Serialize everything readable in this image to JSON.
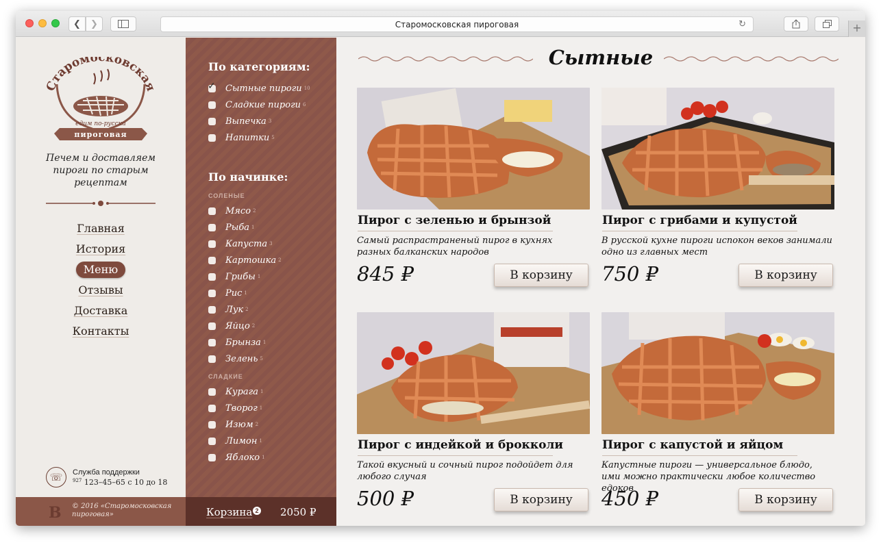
{
  "browser": {
    "url_title": "Старомосковская пироговая"
  },
  "brand": {
    "logo_name": "Старомосковская",
    "logo_motto": "едим по-русски",
    "logo_ribbon": "пироговая",
    "tagline": "Печем и доставляем пироги по старым рецептам",
    "accent": "#8b5748"
  },
  "menu": [
    {
      "label": "Главная"
    },
    {
      "label": "История"
    },
    {
      "label": "Меню",
      "active": true
    },
    {
      "label": "Отзывы"
    },
    {
      "label": "Доставка"
    },
    {
      "label": "Контакты"
    }
  ],
  "support": {
    "label": "Служба поддержки",
    "phone_code": "927",
    "phone": "123–45–65",
    "hours": "с 10 до 18"
  },
  "footer": {
    "copyright": "© 2016 «Старомосковская пироговая»"
  },
  "filters": {
    "categories_heading": "По категориям:",
    "categories": [
      {
        "label": "Сытные пироги",
        "count": "10",
        "checked": true
      },
      {
        "label": "Сладкие пироги",
        "count": "6",
        "checked": false
      },
      {
        "label": "Выпечка",
        "count": "3",
        "checked": false
      },
      {
        "label": "Напитки",
        "count": "5",
        "checked": false
      }
    ],
    "filling_heading": "По начинке:",
    "salty_label": "СОЛЕНЫЕ",
    "salty": [
      {
        "label": "Мясо",
        "count": "2"
      },
      {
        "label": "Рыба",
        "count": "1"
      },
      {
        "label": "Капуста",
        "count": "3"
      },
      {
        "label": "Картошка",
        "count": "2"
      },
      {
        "label": "Грибы",
        "count": "1"
      },
      {
        "label": "Рис",
        "count": "1"
      },
      {
        "label": "Лук",
        "count": "2"
      },
      {
        "label": "Яйцо",
        "count": "2"
      },
      {
        "label": "Брынза",
        "count": "1"
      },
      {
        "label": "Зелень",
        "count": "5"
      }
    ],
    "sweet_label": "СЛАДКИЕ",
    "sweet": [
      {
        "label": "Курага",
        "count": "1"
      },
      {
        "label": "Творог",
        "count": "1"
      },
      {
        "label": "Изюм",
        "count": "2"
      },
      {
        "label": "Лимон",
        "count": "1"
      },
      {
        "label": "Яблоко",
        "count": "1"
      }
    ]
  },
  "cart": {
    "label": "Корзина",
    "count": "2",
    "total": "2050 ₽"
  },
  "main": {
    "title": "Сытные",
    "button_label": "В корзину",
    "products": [
      {
        "title": "Пирог с зеленью и брынзой",
        "desc": "Самый распрастраненый пирог в кухнях разных балканских народов",
        "price": "845 ₽"
      },
      {
        "title": "Пирог с грибами и купустой",
        "desc": "В русской кухне пироги испокон веков занимали одно из главных мест",
        "price": "750 ₽"
      },
      {
        "title": "Пирог с индейкой и брокколи",
        "desc": "Такой вкусный и сочный пирог подойдет для любого случая",
        "price": "500 ₽"
      },
      {
        "title": "Пирог с капустой и яйцом",
        "desc": "Капустные пироги — универсальное блюдо, ими можно практически любое количество едоков",
        "price": "450 ₽"
      }
    ]
  }
}
